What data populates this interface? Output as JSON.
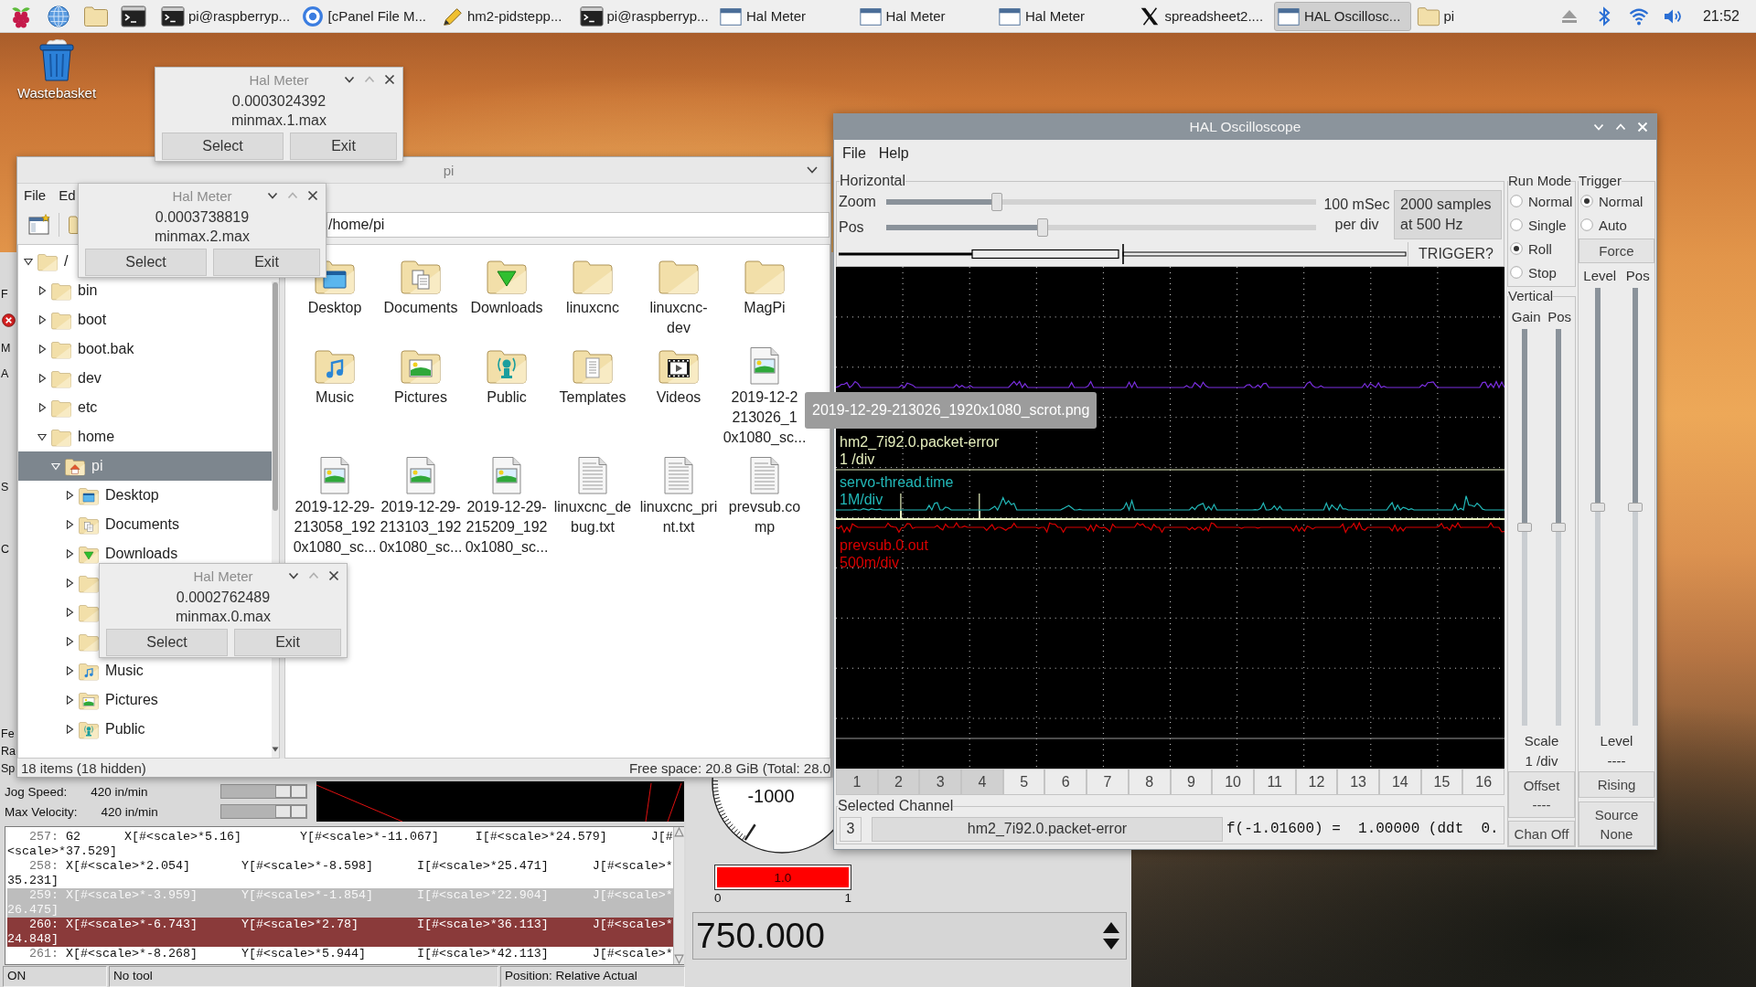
{
  "taskbar": {
    "tasks": [
      {
        "label": "pi@raspberryp...",
        "kind": "terminal",
        "selected": false
      },
      {
        "label": "[cPanel File M...",
        "kind": "browser",
        "selected": false
      },
      {
        "label": "hm2-pidstepp...",
        "kind": "pencil",
        "selected": false
      },
      {
        "label": "pi@raspberryp...",
        "kind": "terminal",
        "selected": false
      },
      {
        "label": "Hal Meter",
        "kind": "window",
        "selected": false
      },
      {
        "label": "Hal Meter",
        "kind": "window",
        "selected": false
      },
      {
        "label": "Hal Meter",
        "kind": "window",
        "selected": false
      },
      {
        "label": "spreadsheet2....",
        "kind": "x",
        "selected": false
      },
      {
        "label": "HAL Oscillosc...",
        "kind": "window",
        "selected": true
      },
      {
        "label": "pi",
        "kind": "folder",
        "selected": false
      }
    ],
    "clock": "21:52"
  },
  "desktop": {
    "icons": [
      {
        "label": "Wastebasket"
      }
    ]
  },
  "axis": {
    "edge_labels": [
      "F",
      "M",
      "A",
      "S",
      "C",
      "Fe",
      "Ra",
      "Sp"
    ],
    "sliders": [
      {
        "label": "Jog Speed:",
        "value": "420 in/min",
        "level": 1
      },
      {
        "label": "Max Velocity:",
        "value": "420 in/min",
        "level": 1
      }
    ],
    "gcode": [
      {
        "number": "257:",
        "text": "G2      X[#<scale>*5.16]        Y[#<scale>*-11.067]     I[#<scale>*24.579]      J[#\n<scale>*37.529]",
        "kind": "normal"
      },
      {
        "number": "258:",
        "text": "X[#<scale>*2.054]       Y[#<scale>*-8.598]      I[#<scale>*25.471]      J[#<scale>*\n35.231]",
        "kind": "normal"
      },
      {
        "number": "259:",
        "text": "X[#<scale>*-3.959]      Y[#<scale>*-1.854]      I[#<scale>*22.904]      J[#<scale>*\n26.475]",
        "kind": "executed"
      },
      {
        "number": "260:",
        "text": "X[#<scale>*-6.743]      Y[#<scale>*2.78]        I[#<scale>*36.113]      J[#<scale>*\n24.848]",
        "kind": "current"
      },
      {
        "number": "261:",
        "text": "X[#<scale>*-8.268]      Y[#<scale>*5.944]       I[#<scale>*42.113]      J[#<scale>*",
        "kind": "normal"
      }
    ],
    "status_bar": [
      "ON",
      "No tool",
      "Position: Relative Actual"
    ]
  },
  "pyvcp": {
    "dial_label": "-1000",
    "bar": {
      "text": "1.0",
      "level": 1,
      "min": "0",
      "max": "1"
    },
    "number": "750.000"
  },
  "file_manager": {
    "title": "pi",
    "menu": [
      "File",
      "Ed"
    ],
    "location": "/home/pi",
    "tree": [
      {
        "label": "/",
        "kind": "folder",
        "expanded": true,
        "selected": false,
        "children": [
          {
            "label": "bin",
            "kind": "folder",
            "expanded": false,
            "selected": false
          },
          {
            "label": "boot",
            "kind": "folder",
            "expanded": false,
            "selected": false
          },
          {
            "label": "boot.bak",
            "kind": "folder",
            "expanded": false,
            "selected": false
          },
          {
            "label": "dev",
            "kind": "folder",
            "expanded": false,
            "selected": false
          },
          {
            "label": "etc",
            "kind": "folder",
            "expanded": false,
            "selected": false
          },
          {
            "label": "home",
            "kind": "folder",
            "expanded": true,
            "selected": false,
            "children": [
              {
                "label": "pi",
                "kind": "home",
                "expanded": true,
                "selected": true,
                "children": [
                  {
                    "label": "Desktop",
                    "kind": "desktop",
                    "expanded": false,
                    "selected": false
                  },
                  {
                    "label": "Documents",
                    "kind": "documents",
                    "expanded": false,
                    "selected": false
                  },
                  {
                    "label": "Downloads",
                    "kind": "downloads",
                    "expanded": false,
                    "selected": false
                  },
                  {
                    "kind": "folder",
                    "expanded": false,
                    "selected": false
                  },
                  {
                    "kind": "folder",
                    "expanded": false,
                    "selected": false
                  },
                  {
                    "kind": "folder",
                    "expanded": false,
                    "selected": false
                  },
                  {
                    "label": "Music",
                    "kind": "music",
                    "expanded": false,
                    "selected": false
                  },
                  {
                    "label": "Pictures",
                    "kind": "pictures",
                    "expanded": false,
                    "selected": false
                  },
                  {
                    "label": "Public",
                    "kind": "public",
                    "expanded": false,
                    "selected": false
                  }
                ]
              }
            ]
          }
        ]
      }
    ],
    "items": [
      {
        "label": "Desktop",
        "kind": "desktop"
      },
      {
        "label": "Documents",
        "kind": "documents"
      },
      {
        "label": "Downloads",
        "kind": "downloads"
      },
      {
        "label": "linuxcnc",
        "kind": "folder"
      },
      {
        "label": "linuxcnc-\ndev",
        "kind": "folder"
      },
      {
        "label": "MagPi",
        "kind": "folder"
      },
      {
        "label": "Music",
        "kind": "music"
      },
      {
        "label": "Pictures",
        "kind": "pictures"
      },
      {
        "label": "Public",
        "kind": "public"
      },
      {
        "label": "Templates",
        "kind": "templates"
      },
      {
        "label": "Videos",
        "kind": "videos"
      },
      {
        "label": "2019-12-2\n213026_1\n0x1080_sc...",
        "kind": "image"
      },
      {
        "label": "2019-12-29-\n213058_192\n0x1080_sc...",
        "kind": "image"
      },
      {
        "label": "2019-12-29-\n213103_192\n0x1080_sc...",
        "kind": "image"
      },
      {
        "label": "2019-12-29-\n215209_192\n0x1080_sc...",
        "kind": "image"
      },
      {
        "label": "linuxcnc_de\nbug.txt",
        "kind": "text"
      },
      {
        "label": "linuxcnc_pri\nnt.txt",
        "kind": "text"
      },
      {
        "label": "prevsub.co\nmp",
        "kind": "text"
      }
    ],
    "status": [
      "18 items (18 hidden)",
      "Free space: 20.8 GiB (Total: 28.0"
    ]
  },
  "oscilloscope": {
    "title": "HAL Oscilloscope",
    "menu": [
      "File",
      "Help"
    ],
    "horizontal": {
      "label": "Horizontal",
      "sliders": [
        {
          "label": "Zoom",
          "level": 0.25
        },
        {
          "label": "Pos",
          "level": 0.36
        }
      ],
      "rate": "100 mSec\nper div",
      "samples": "2000 samples\nat 500 Hz",
      "trigger_status": "TRIGGER?"
    },
    "traces": [
      {
        "kind": "bumps",
        "color": "#7b2fe0"
      },
      {
        "kind": "pulse",
        "name": "hm2_7i92.0.packet-error",
        "scale": "1 /div",
        "color": "#e6efbe"
      },
      {
        "kind": "spikes",
        "name": "servo-thread.time",
        "scale": "1M/div",
        "color": "#22b8b8"
      },
      {
        "kind": "noise",
        "name": "prevsub.0.out",
        "scale": "500m/div",
        "color": "#d80000"
      }
    ],
    "channel_buttons": [
      {
        "label": "1",
        "on": true
      },
      {
        "label": "2",
        "on": true
      },
      {
        "label": "3",
        "on": true
      },
      {
        "label": "4",
        "on": true
      },
      {
        "label": "5",
        "on": false
      },
      {
        "label": "6",
        "on": false
      },
      {
        "label": "7",
        "on": false
      },
      {
        "label": "8",
        "on": false
      },
      {
        "label": "9",
        "on": false
      },
      {
        "label": "10",
        "on": false
      },
      {
        "label": "11",
        "on": false
      },
      {
        "label": "12",
        "on": false
      },
      {
        "label": "13",
        "on": false
      },
      {
        "label": "14",
        "on": false
      },
      {
        "label": "15",
        "on": false
      },
      {
        "label": "16",
        "on": false
      }
    ],
    "selected_channel": {
      "label": "Selected Channel",
      "number": "3",
      "name": "hm2_7i92.0.packet-error",
      "readout": "f(-1.01600) =  1.00000 (ddt  0."
    },
    "run_mode": {
      "label": "Run Mode",
      "options": [
        {
          "label": "Normal",
          "selected": false
        },
        {
          "label": "Single",
          "selected": false
        },
        {
          "label": "Roll",
          "selected": true
        },
        {
          "label": "Stop",
          "selected": false
        }
      ]
    },
    "vertical": {
      "label": "Vertical",
      "slider_labels": [
        "Gain",
        "Pos"
      ],
      "sliders": [
        {
          "level": 0.5
        },
        {
          "level": 0.5
        }
      ],
      "scale_label": "Scale",
      "scale_value": "1 /div",
      "offset": "Offset\n----",
      "chan_off": "Chan Off"
    },
    "trigger": {
      "label": "Trigger",
      "options": [
        {
          "label": "Normal",
          "selected": true
        },
        {
          "label": "Auto",
          "selected": false
        }
      ],
      "force": "Force",
      "slider_labels": [
        "Level",
        "Pos"
      ],
      "sliders": [
        {
          "level": 0.5
        },
        {
          "level": 0.5
        }
      ],
      "level_label": "Level",
      "level_value": "----",
      "edge": "Rising",
      "source": "Source\nNone"
    }
  },
  "hal_meters": [
    {
      "title": "Hal Meter",
      "value": "0.0003024392",
      "pin": "minmax.1.max",
      "buttons": [
        "Select",
        "Exit"
      ]
    },
    {
      "title": "Hal Meter",
      "value": "0.0003738819",
      "pin": "minmax.2.max",
      "buttons": [
        "Select",
        "Exit"
      ]
    },
    {
      "title": "Hal Meter",
      "value": "0.0002762489",
      "pin": "minmax.0.max",
      "buttons": [
        "Select",
        "Exit"
      ]
    }
  ],
  "tooltip": "2019-12-29-213026_1920x1080_scrot.png"
}
